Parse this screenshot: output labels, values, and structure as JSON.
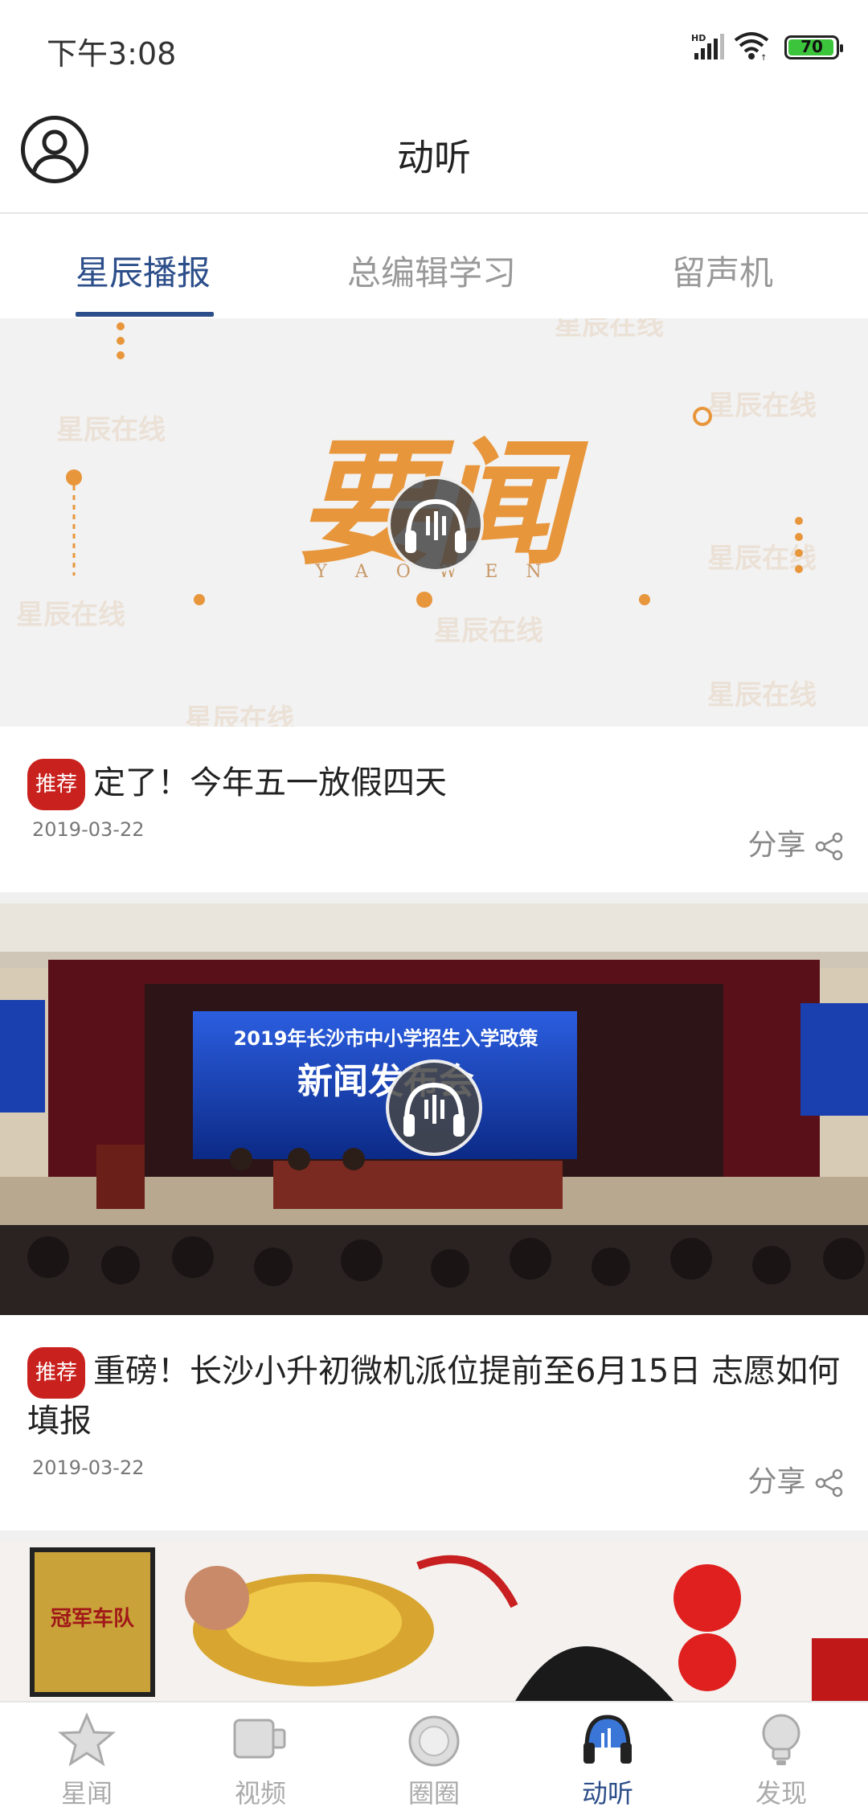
{
  "status_bar": {
    "time": "下午3:08",
    "network_label": "HD",
    "battery": "70"
  },
  "header": {
    "title": "动听"
  },
  "tabs": [
    {
      "label": "星辰播报",
      "active": true
    },
    {
      "label": "总编辑学习",
      "active": false
    },
    {
      "label": "留声机",
      "active": false
    }
  ],
  "cards": [
    {
      "banner_title": "要闻",
      "banner_subtitle": "Y A O W E N",
      "watermark": "星辰在线",
      "tag": "推荐",
      "title": "定了！今年五一放假四天",
      "date": "2019-03-22",
      "share_label": "分享"
    },
    {
      "screen_text": "2019年长沙市中小学招生入学政策",
      "screen_text2": "新闻发布会",
      "tag": "推荐",
      "title": "重磅！长沙小升初微机派位提前至6月15日 志愿如何填报",
      "date": "2019-03-22",
      "share_label": "分享"
    },
    {
      "trophy_text": "冠军车队"
    }
  ],
  "bottom_nav": [
    {
      "label": "星闻",
      "icon": "star-icon",
      "active": false
    },
    {
      "label": "视频",
      "icon": "video-icon",
      "active": false
    },
    {
      "label": "圈圈",
      "icon": "circle-icon",
      "active": false
    },
    {
      "label": "动听",
      "icon": "headphones-icon",
      "active": true
    },
    {
      "label": "发现",
      "icon": "bulb-icon",
      "active": false
    }
  ],
  "colors": {
    "accent": "#2c4e8a",
    "tag_red": "#c9211e",
    "banner_orange": "#e8963c"
  }
}
